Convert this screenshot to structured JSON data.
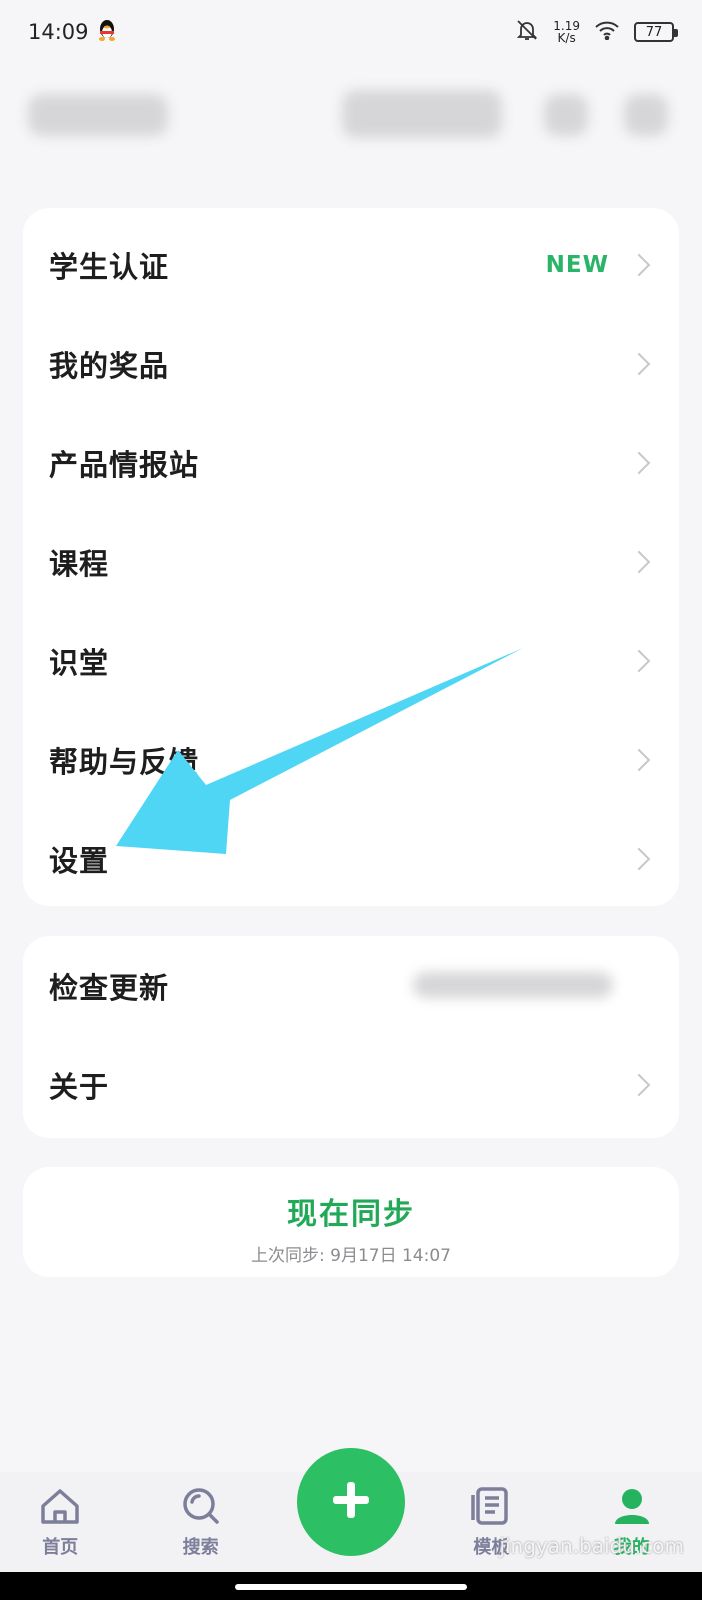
{
  "status_bar": {
    "time": "14:09",
    "net_speed_value": "1.19",
    "net_speed_unit": "K/s",
    "battery": "77"
  },
  "menu": {
    "items": [
      {
        "label": "学生认证",
        "badge": "NEW"
      },
      {
        "label": "我的奖品"
      },
      {
        "label": "产品情报站"
      },
      {
        "label": "课程"
      },
      {
        "label": "识堂"
      },
      {
        "label": "帮助与反馈"
      },
      {
        "label": "设置"
      }
    ]
  },
  "about_card": {
    "items": [
      {
        "label": "检查更新"
      },
      {
        "label": "关于"
      }
    ]
  },
  "sync": {
    "title": "现在同步",
    "last_sync": "上次同步: 9月17日 14:07"
  },
  "bottom_nav": {
    "home": "首页",
    "search": "搜索",
    "templates": "模板",
    "mine": "我的"
  },
  "colors": {
    "accent": "#2dbf63",
    "arrow": "#4fd6f5",
    "nav_inactive": "#7d7e9a"
  },
  "watermark": {
    "text": "jingyan.baidu.com"
  }
}
